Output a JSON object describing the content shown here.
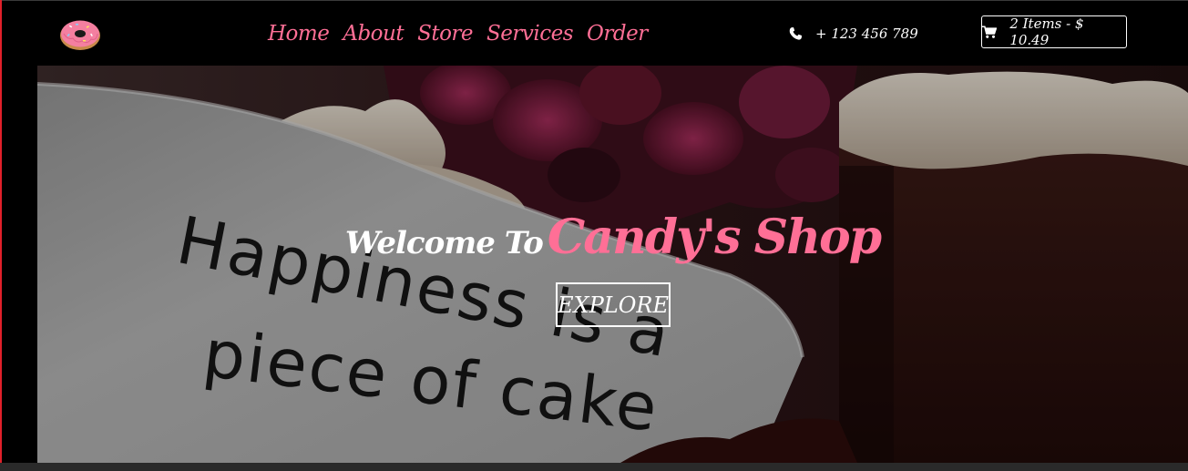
{
  "nav": {
    "links": [
      "Home",
      "About",
      "Store",
      "Services",
      "Order"
    ],
    "logo_icon": "donut-icon"
  },
  "contact": {
    "phone": "+ 123 456 789",
    "icon": "phone-icon"
  },
  "cart": {
    "label": "2 Items - $ 10.49",
    "icon": "cart-icon"
  },
  "hero": {
    "welcome": "Welcome To",
    "brand": "Candy's Shop",
    "button": "EXPLORE",
    "plate_text_line1": "Happiness is a",
    "plate_text_line2": "piece of cake"
  },
  "colors": {
    "accent": "#ff6f96",
    "background": "#000000",
    "text": "#ffffff"
  }
}
